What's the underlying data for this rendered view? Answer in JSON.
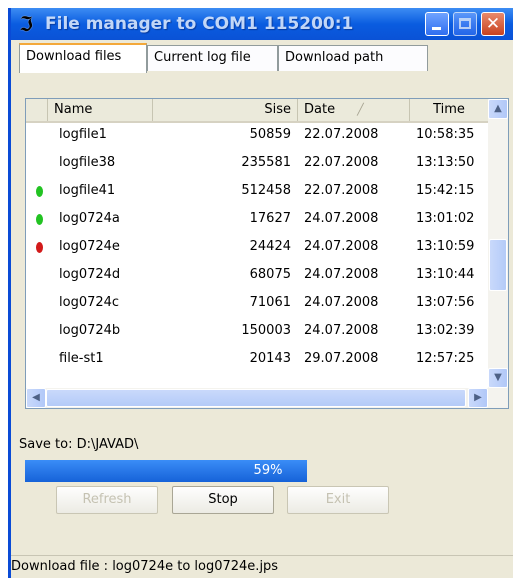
{
  "window": {
    "title": "File manager to  COM1 115200:1",
    "icon": "tool-icon"
  },
  "tabs": [
    {
      "label": "Download files",
      "active": true
    },
    {
      "label": "Current log file",
      "active": false
    },
    {
      "label": "Download path",
      "active": false
    }
  ],
  "table": {
    "columns": [
      "Name",
      "Sise",
      "Date",
      "Time"
    ],
    "sort_column": "Date",
    "rows": [
      {
        "name": "logfile1",
        "size": "50859",
        "date": "22.07.2008",
        "time": "10:58:35",
        "status": ""
      },
      {
        "name": "logfile38",
        "size": "235581",
        "date": "22.07.2008",
        "time": "13:13:50",
        "status": ""
      },
      {
        "name": "logfile41",
        "size": "512458",
        "date": "22.07.2008",
        "time": "15:42:15",
        "status": "green"
      },
      {
        "name": "log0724a",
        "size": "17627",
        "date": "24.07.2008",
        "time": "13:01:02",
        "status": "green"
      },
      {
        "name": "log0724e",
        "size": "24424",
        "date": "24.07.2008",
        "time": "13:10:59",
        "status": "red"
      },
      {
        "name": "log0724d",
        "size": "68075",
        "date": "24.07.2008",
        "time": "13:10:44",
        "status": ""
      },
      {
        "name": "log0724c",
        "size": "71061",
        "date": "24.07.2008",
        "time": "13:07:56",
        "status": ""
      },
      {
        "name": "log0724b",
        "size": "150003",
        "date": "24.07.2008",
        "time": "13:02:39",
        "status": ""
      },
      {
        "name": "file-st1",
        "size": "20143",
        "date": "29.07.2008",
        "time": "12:57:25",
        "status": ""
      }
    ]
  },
  "save_to": "Save to: D:\\JAVAD\\",
  "progress": {
    "label": "59%",
    "fraction": 0.59
  },
  "buttons": {
    "refresh": "Refresh",
    "stop": "Stop",
    "exit": "Exit"
  },
  "status_bar": "Download file : log0724e  to  log0724e.jps",
  "colors": {
    "titlebar": "#0a5ce0",
    "progress": "#1662d8",
    "status_green": "#22c322",
    "status_red": "#d21a1a"
  }
}
